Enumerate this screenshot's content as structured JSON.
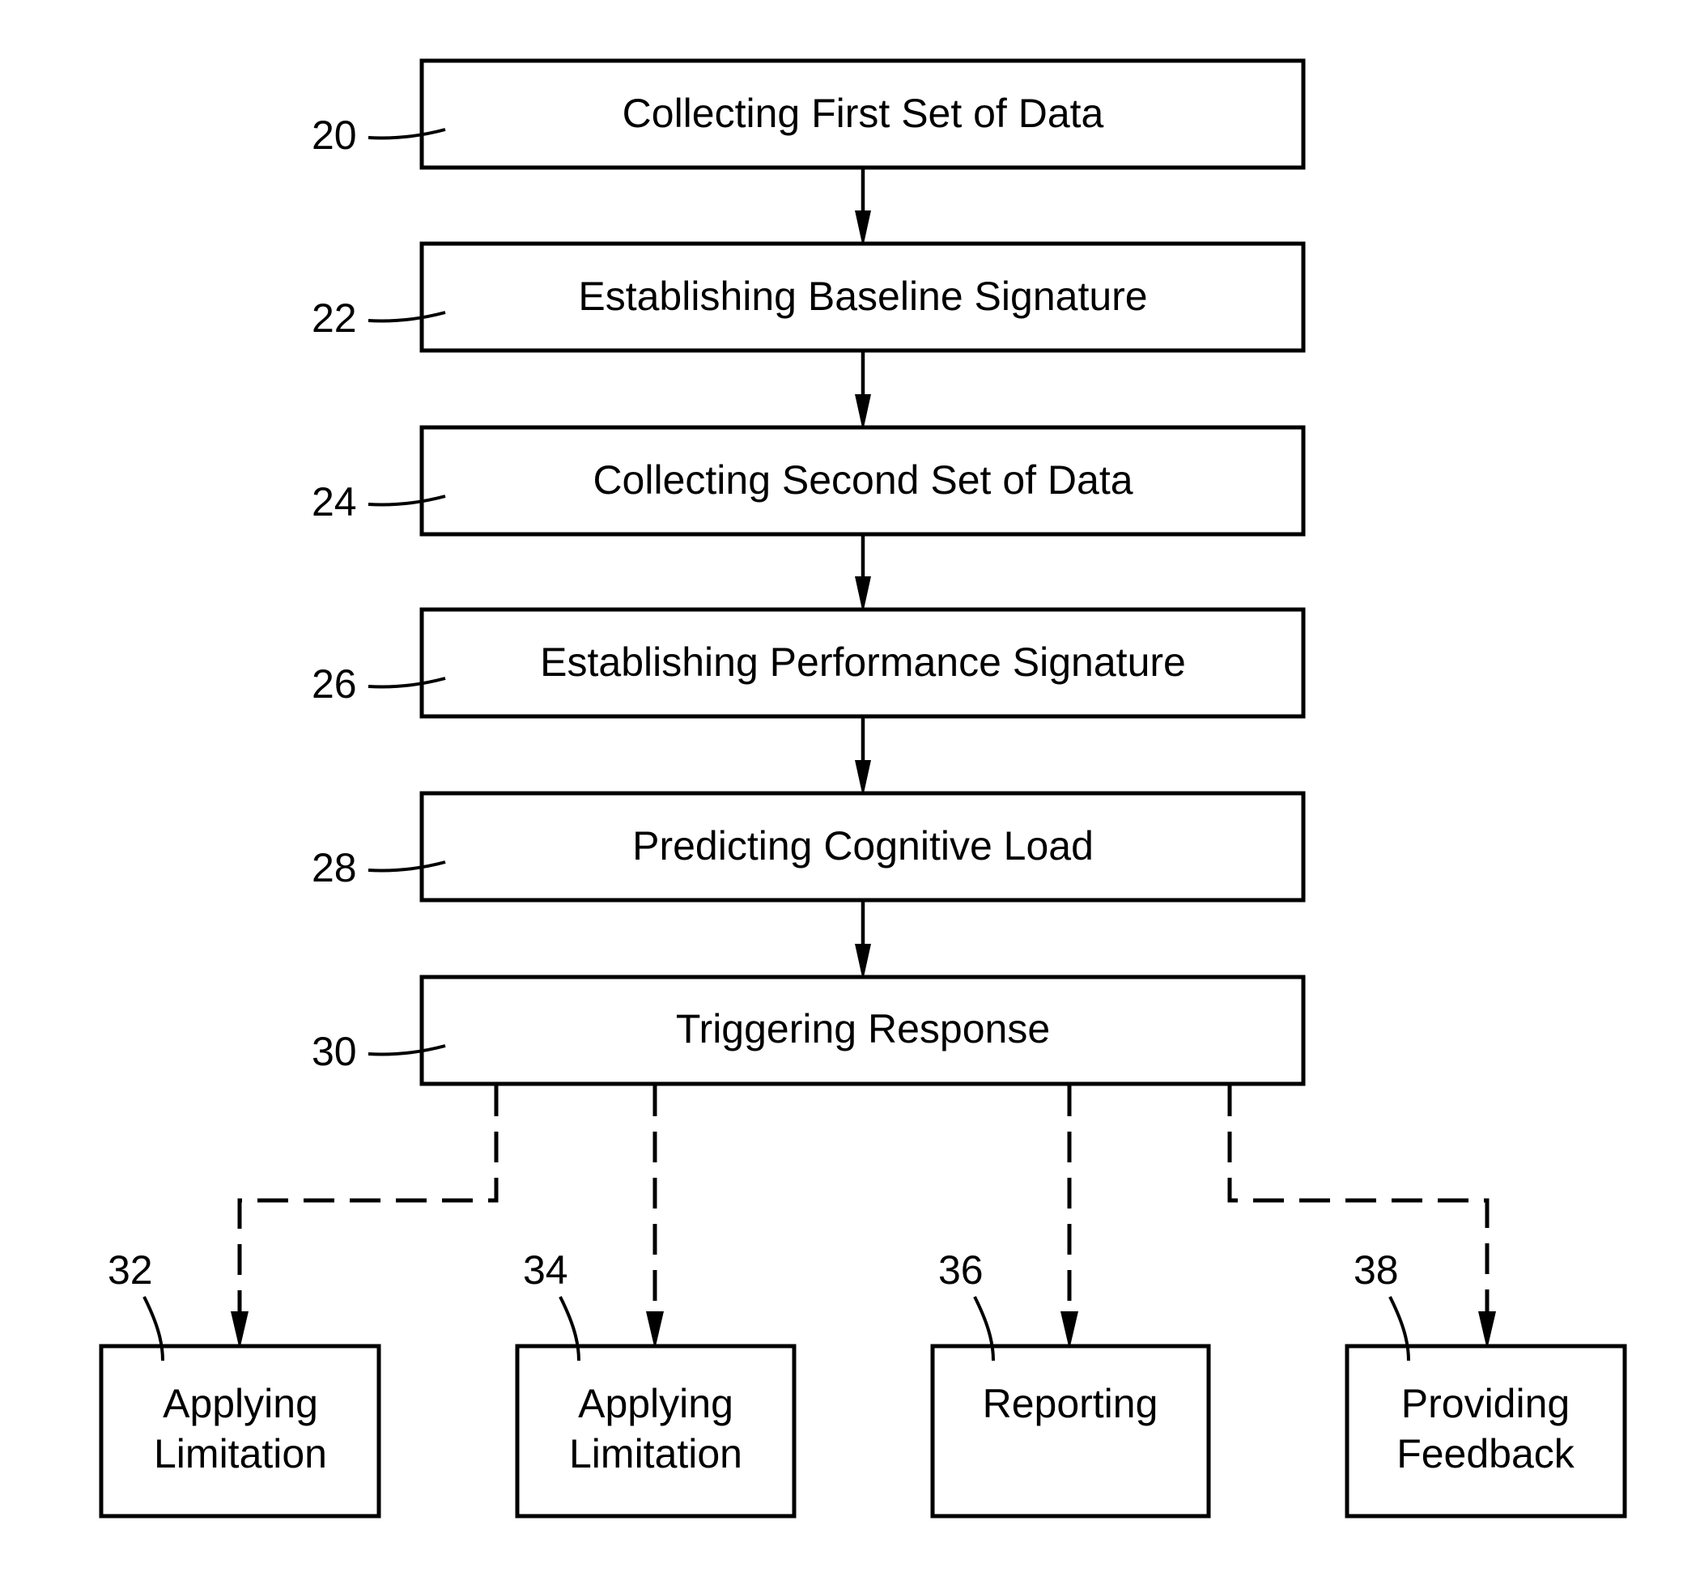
{
  "figure": {
    "main_steps": [
      {
        "ref": "20",
        "label": "Collecting First Set of Data"
      },
      {
        "ref": "22",
        "label": "Establishing Baseline Signature"
      },
      {
        "ref": "24",
        "label": "Collecting Second Set of Data"
      },
      {
        "ref": "26",
        "label": "Establishing Performance Signature"
      },
      {
        "ref": "28",
        "label": "Predicting Cognitive Load"
      },
      {
        "ref": "30",
        "label": "Triggering Response"
      }
    ],
    "responses": [
      {
        "ref": "32",
        "lines": [
          "Applying",
          "Limitation"
        ]
      },
      {
        "ref": "34",
        "lines": [
          "Applying",
          "Limitation"
        ]
      },
      {
        "ref": "36",
        "lines": [
          "Reporting"
        ]
      },
      {
        "ref": "38",
        "lines": [
          "Providing",
          "Feedback"
        ]
      }
    ],
    "connectors": {
      "main_flow": "solid-arrow",
      "response_flow": "dashed-arrow"
    }
  }
}
